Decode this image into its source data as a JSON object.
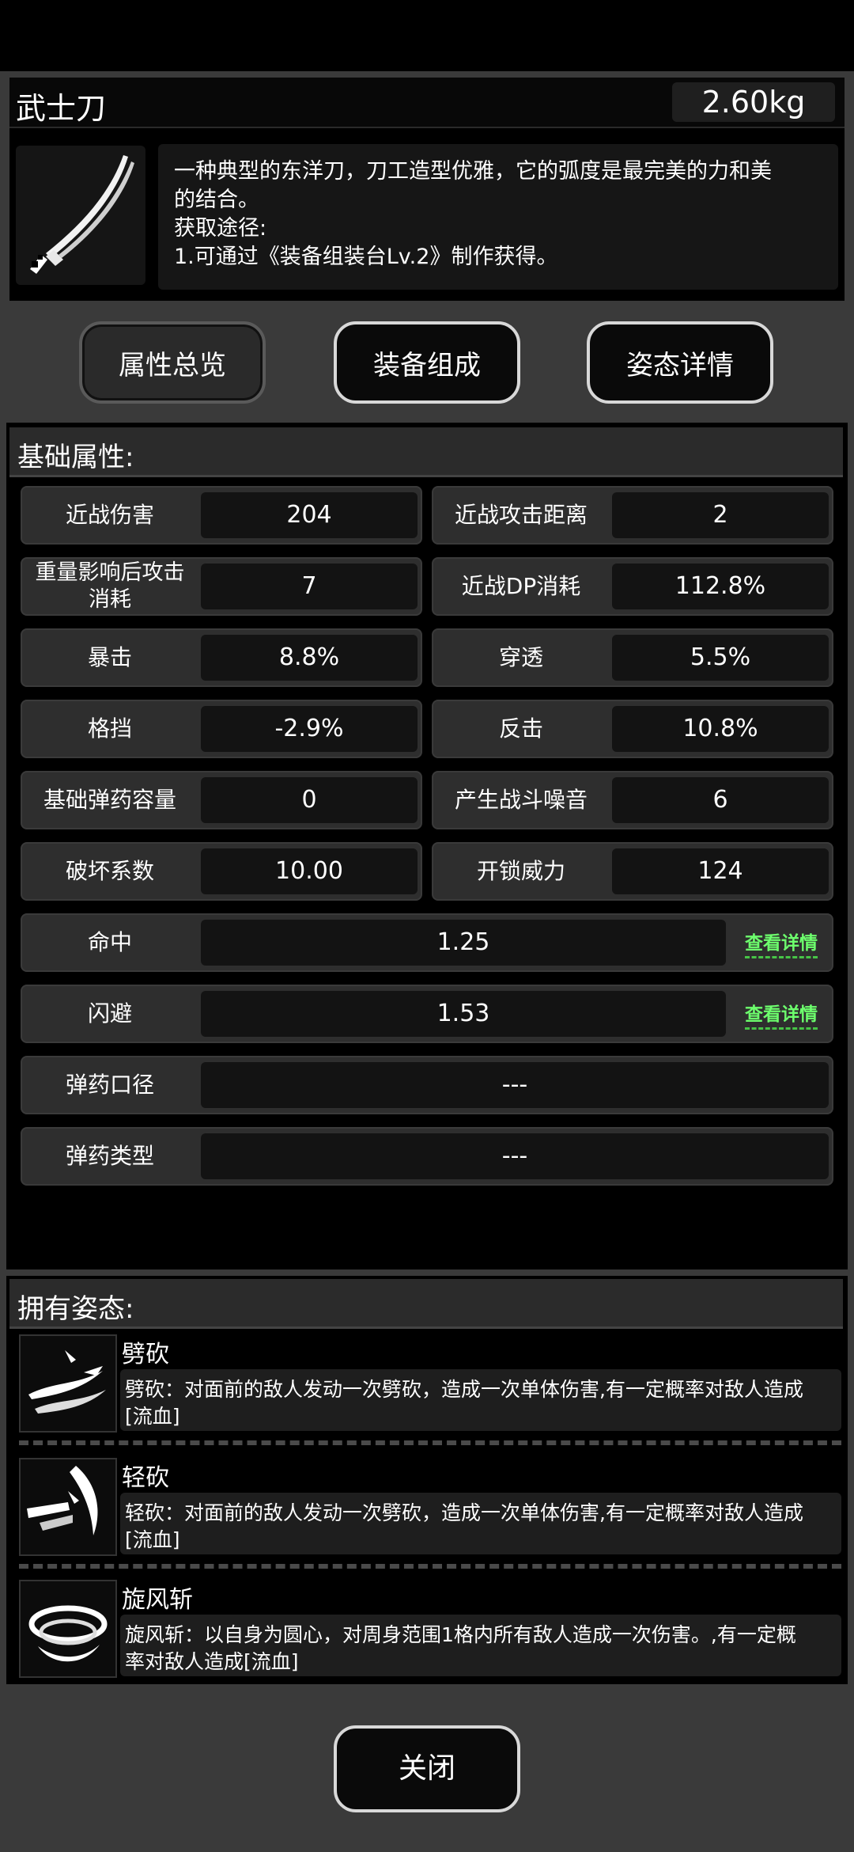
{
  "item": {
    "name": "武士刀",
    "weight": "2.60kg",
    "icon": "katana-icon",
    "description_lines": [
      "一种典型的东洋刀，刀工造型优雅，它的弧度是最完美的力和美",
      "的结合。",
      "获取途径:",
      "1.可通过《装备组装台Lv.2》制作获得。"
    ]
  },
  "tabs": [
    {
      "label": "属性总览",
      "selected": true
    },
    {
      "label": "装备组成",
      "selected": false
    },
    {
      "label": "姿态详情",
      "selected": false
    }
  ],
  "basic": {
    "title": "基础属性:",
    "pairs": [
      {
        "l1": "近战伤害",
        "v1": "204",
        "l2": "近战攻击距离",
        "v2": "2"
      },
      {
        "l1": "重量影响后攻击消耗",
        "v1": "7",
        "l2": "近战DP消耗",
        "v2": "112.8%"
      },
      {
        "l1": "暴击",
        "v1": "8.8%",
        "l2": "穿透",
        "v2": "5.5%"
      },
      {
        "l1": "格挡",
        "v1": "-2.9%",
        "l2": "反击",
        "v2": "10.8%"
      },
      {
        "l1": "基础弹药容量",
        "v1": "0",
        "l2": "产生战斗噪音",
        "v2": "6"
      },
      {
        "l1": "破坏系数",
        "v1": "10.00",
        "l2": "开锁威力",
        "v2": "124"
      }
    ],
    "wide": [
      {
        "label": "命中",
        "value": "1.25",
        "link": "查看详情"
      },
      {
        "label": "闪避",
        "value": "1.53",
        "link": "查看详情"
      },
      {
        "label": "弹药口径",
        "value": "---"
      },
      {
        "label": "弹药类型",
        "value": "---"
      }
    ]
  },
  "stances": {
    "title": "拥有姿态:",
    "items": [
      {
        "name": "劈砍",
        "icon": "chop-slash-icon",
        "desc_lines": [
          "劈砍：对面前的敌人发动一次劈砍，造成一次单体伤害,有一定概率对敌人造成",
          "[流血]"
        ]
      },
      {
        "name": "轻砍",
        "icon": "light-slash-icon",
        "desc_lines": [
          "轻砍：对面前的敌人发动一次劈砍，造成一次单体伤害,有一定概率对敌人造成",
          "[流血]"
        ]
      },
      {
        "name": "旋风斩",
        "icon": "whirlwind-slash-icon",
        "desc_lines": [
          "旋风斩：以自身为圆心，对周身范围1格内所有敌人造成一次伤害。,有一定概",
          "率对敌人造成[流血]"
        ]
      }
    ]
  },
  "footer": {
    "close_label": "关闭"
  }
}
